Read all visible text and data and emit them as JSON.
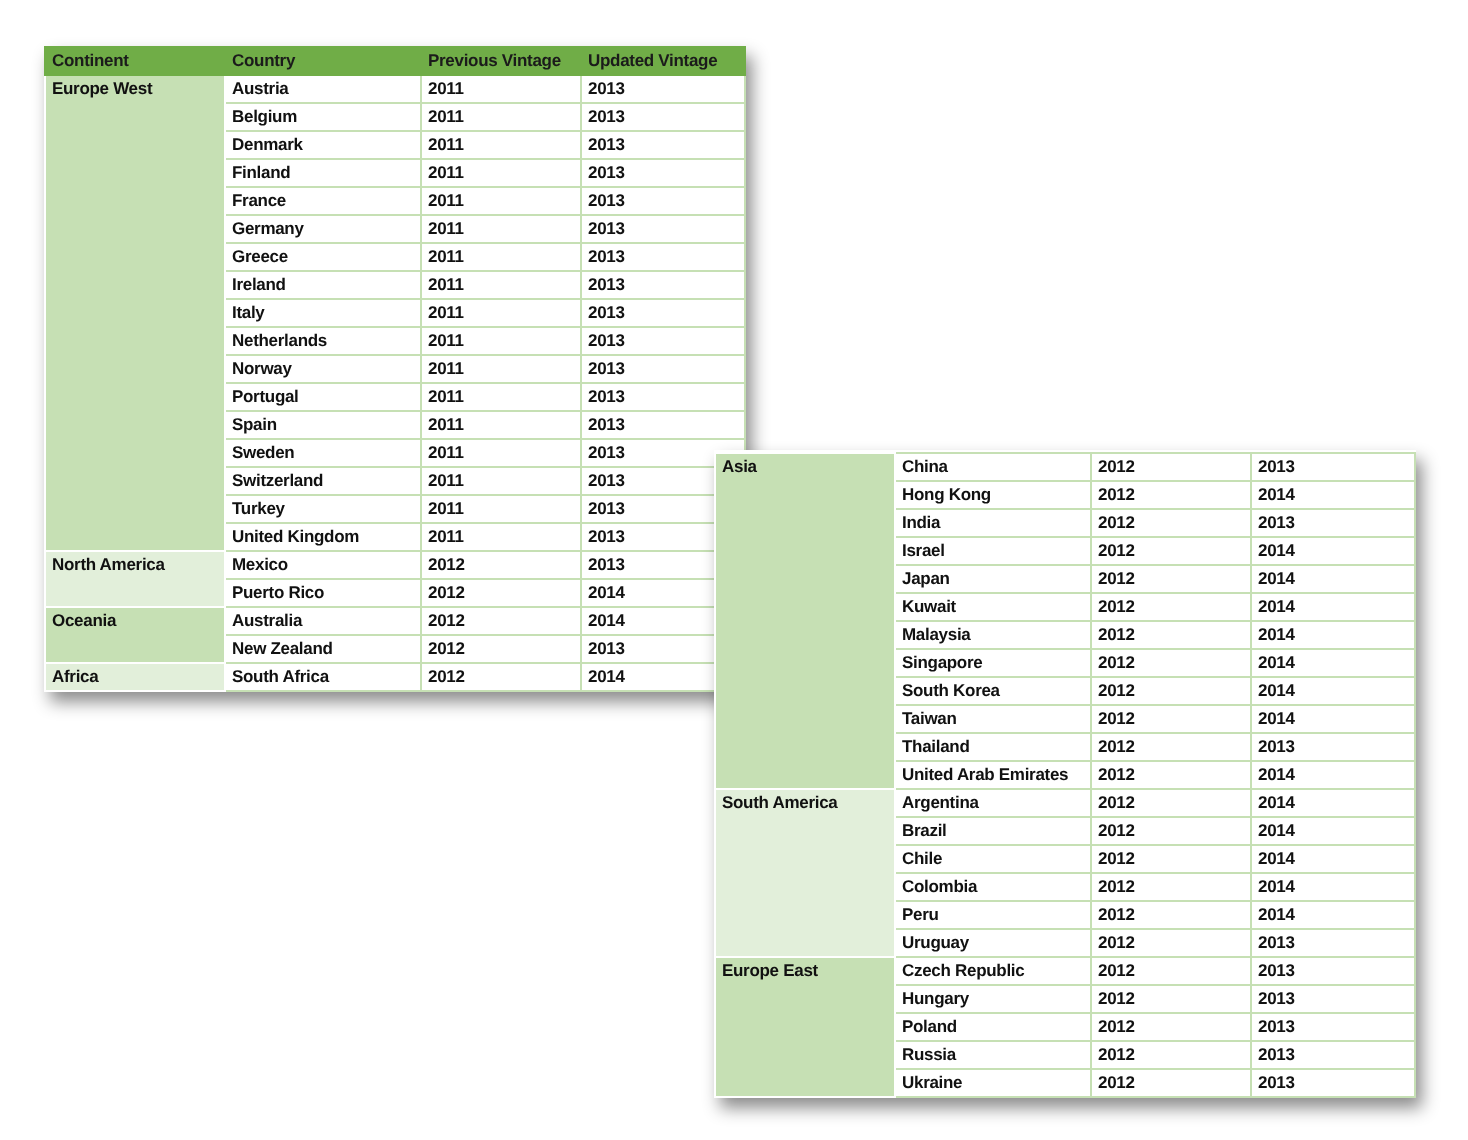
{
  "panels": [
    {
      "columns": [
        "Continent",
        "Country",
        "Previous Vintage",
        "Updated Vintage"
      ],
      "groups": [
        {
          "continent": "Europe West",
          "color": "#c6e0b4",
          "rows": [
            {
              "country": "Austria",
              "previous": "2011",
              "updated": "2013"
            },
            {
              "country": "Belgium",
              "previous": "2011",
              "updated": "2013"
            },
            {
              "country": "Denmark",
              "previous": "2011",
              "updated": "2013"
            },
            {
              "country": "Finland",
              "previous": "2011",
              "updated": "2013"
            },
            {
              "country": "France",
              "previous": "2011",
              "updated": "2013"
            },
            {
              "country": "Germany",
              "previous": "2011",
              "updated": "2013"
            },
            {
              "country": "Greece",
              "previous": "2011",
              "updated": "2013"
            },
            {
              "country": "Ireland",
              "previous": "2011",
              "updated": "2013"
            },
            {
              "country": "Italy",
              "previous": "2011",
              "updated": "2013"
            },
            {
              "country": "Netherlands",
              "previous": "2011",
              "updated": "2013"
            },
            {
              "country": "Norway",
              "previous": "2011",
              "updated": "2013"
            },
            {
              "country": "Portugal",
              "previous": "2011",
              "updated": "2013"
            },
            {
              "country": "Spain",
              "previous": "2011",
              "updated": "2013"
            },
            {
              "country": "Sweden",
              "previous": "2011",
              "updated": "2013"
            },
            {
              "country": "Switzerland",
              "previous": "2011",
              "updated": "2013"
            },
            {
              "country": "Turkey",
              "previous": "2011",
              "updated": "2013"
            },
            {
              "country": "United Kingdom",
              "previous": "2011",
              "updated": "2013"
            }
          ]
        },
        {
          "continent": "North America",
          "color": "#e2efda",
          "rows": [
            {
              "country": "Mexico",
              "previous": "2012",
              "updated": "2013"
            },
            {
              "country": "Puerto Rico",
              "previous": "2012",
              "updated": "2014"
            }
          ]
        },
        {
          "continent": "Oceania",
          "color": "#c6e0b4",
          "rows": [
            {
              "country": "Australia",
              "previous": "2012",
              "updated": "2014"
            },
            {
              "country": "New Zealand",
              "previous": "2012",
              "updated": "2013"
            }
          ]
        },
        {
          "continent": "Africa",
          "color": "#e2efda",
          "rows": [
            {
              "country": "South Africa",
              "previous": "2012",
              "updated": "2014"
            }
          ]
        }
      ]
    },
    {
      "groups": [
        {
          "continent": "Asia",
          "color": "#c6e0b4",
          "rows": [
            {
              "country": "China",
              "previous": "2012",
              "updated": "2013"
            },
            {
              "country": "Hong Kong",
              "previous": "2012",
              "updated": "2014"
            },
            {
              "country": "India",
              "previous": "2012",
              "updated": "2013"
            },
            {
              "country": "Israel",
              "previous": "2012",
              "updated": "2014"
            },
            {
              "country": "Japan",
              "previous": "2012",
              "updated": "2014"
            },
            {
              "country": "Kuwait",
              "previous": "2012",
              "updated": "2014"
            },
            {
              "country": "Malaysia",
              "previous": "2012",
              "updated": "2014"
            },
            {
              "country": "Singapore",
              "previous": "2012",
              "updated": "2014"
            },
            {
              "country": "South Korea",
              "previous": "2012",
              "updated": "2014"
            },
            {
              "country": "Taiwan",
              "previous": "2012",
              "updated": "2014"
            },
            {
              "country": "Thailand",
              "previous": "2012",
              "updated": "2013"
            },
            {
              "country": "United Arab Emirates",
              "previous": "2012",
              "updated": "2014"
            }
          ]
        },
        {
          "continent": "South America",
          "color": "#e2efda",
          "rows": [
            {
              "country": "Argentina",
              "previous": "2012",
              "updated": "2014"
            },
            {
              "country": "Brazil",
              "previous": "2012",
              "updated": "2014"
            },
            {
              "country": "Chile",
              "previous": "2012",
              "updated": "2014"
            },
            {
              "country": "Colombia",
              "previous": "2012",
              "updated": "2014"
            },
            {
              "country": "Peru",
              "previous": "2012",
              "updated": "2014"
            },
            {
              "country": "Uruguay",
              "previous": "2012",
              "updated": "2013"
            }
          ]
        },
        {
          "continent": "Europe East",
          "color": "#c6e0b4",
          "rows": [
            {
              "country": "Czech Republic",
              "previous": "2012",
              "updated": "2013"
            },
            {
              "country": "Hungary",
              "previous": "2012",
              "updated": "2013"
            },
            {
              "country": "Poland",
              "previous": "2012",
              "updated": "2013"
            },
            {
              "country": "Russia",
              "previous": "2012",
              "updated": "2013"
            },
            {
              "country": "Ukraine",
              "previous": "2012",
              "updated": "2013"
            }
          ]
        }
      ]
    }
  ]
}
